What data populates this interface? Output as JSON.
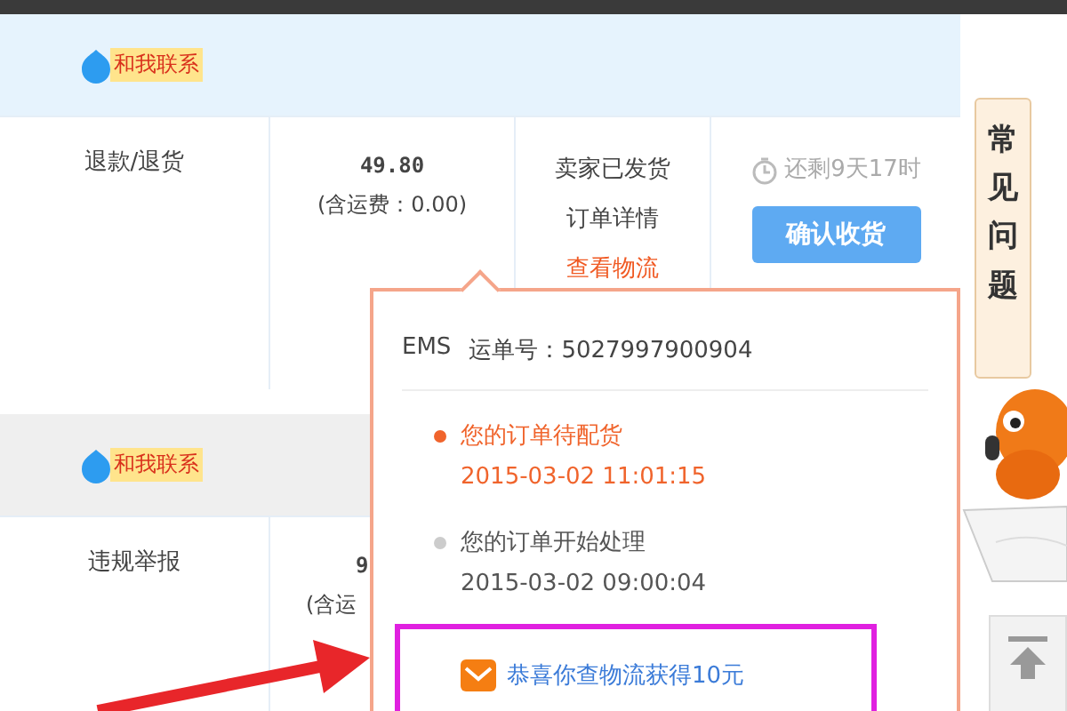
{
  "orders": [
    {
      "contact": "和我联系",
      "highlighted": true,
      "action": "退款/退货",
      "price": "49.80",
      "shipping": "(含运费：0.00)",
      "status": "卖家已发货",
      "details_link": "订单详情",
      "logistics_link": "查看物流",
      "countdown": "还剩9天17时",
      "confirm_button": "确认收货"
    },
    {
      "contact": "和我联系",
      "highlighted": false,
      "action": "违规举报",
      "price": "9",
      "shipping": "(含运"
    }
  ],
  "logistics_popup": {
    "carrier": "EMS",
    "tracking": "运单号：5027997900904",
    "events": [
      {
        "text": "您的订单待配货",
        "time": "2015-03-02 11:01:15",
        "latest": true
      },
      {
        "text": "您的订单开始处理",
        "time": "2015-03-02 09:00:04",
        "latest": false
      }
    ],
    "promo": "恭喜你查物流获得10元"
  },
  "side_tab": {
    "label": "常见问题"
  }
}
